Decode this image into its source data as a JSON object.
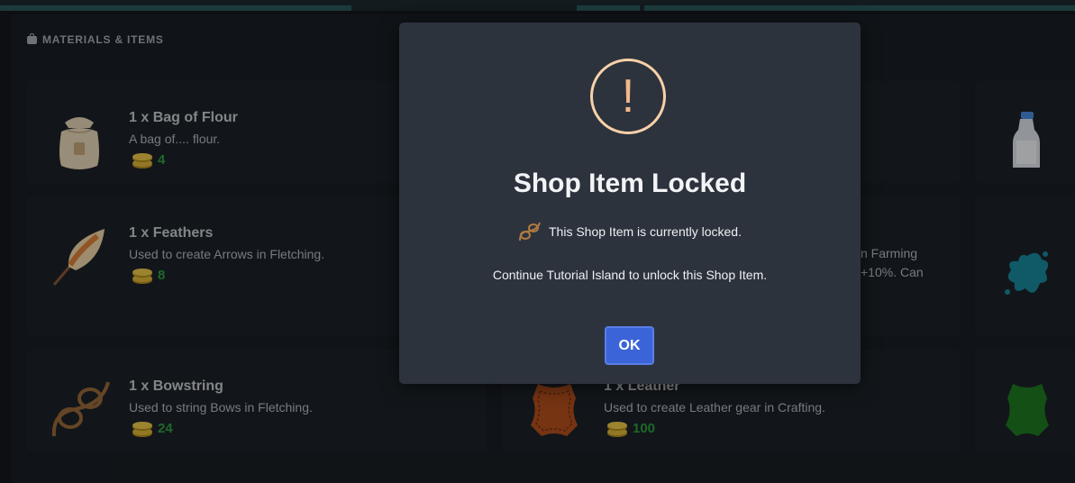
{
  "section": {
    "title": "MATERIALS & ITEMS",
    "icon": "bag-icon"
  },
  "items": [
    {
      "name": "1 x Bag of Flour",
      "desc": "A bag of.... flour.",
      "price": "4",
      "icon": "flour-bag-icon"
    },
    {
      "name": "1 x Feathers",
      "desc": "Used to create Arrows in Fletching.",
      "price": "8",
      "icon": "feather-icon"
    },
    {
      "name": "1 x Bowstring",
      "desc": "Used to string Bows in Fletching.",
      "price": "24",
      "icon": "bowstring-icon"
    },
    {
      "name": "1 x Leather",
      "desc": "Used to create Leather gear in Crafting.",
      "price": "100",
      "icon": "leather-icon"
    }
  ],
  "partial_text": {
    "line1": "n Farming",
    "line2": "+10%. Can"
  },
  "side_icons": [
    "milk-bottle-icon",
    "dye-splash-icon",
    "green-leather-icon"
  ],
  "modal": {
    "title": "Shop Item Locked",
    "line1": "This Shop Item is currently locked.",
    "line2": "Continue Tutorial Island to unlock this Shop Item.",
    "ok_label": "OK",
    "warning_glyph": "!"
  },
  "colors": {
    "price_green": "#2ea043",
    "ok_blue": "#3b64d8",
    "warning_orange": "#f8d1a8"
  }
}
